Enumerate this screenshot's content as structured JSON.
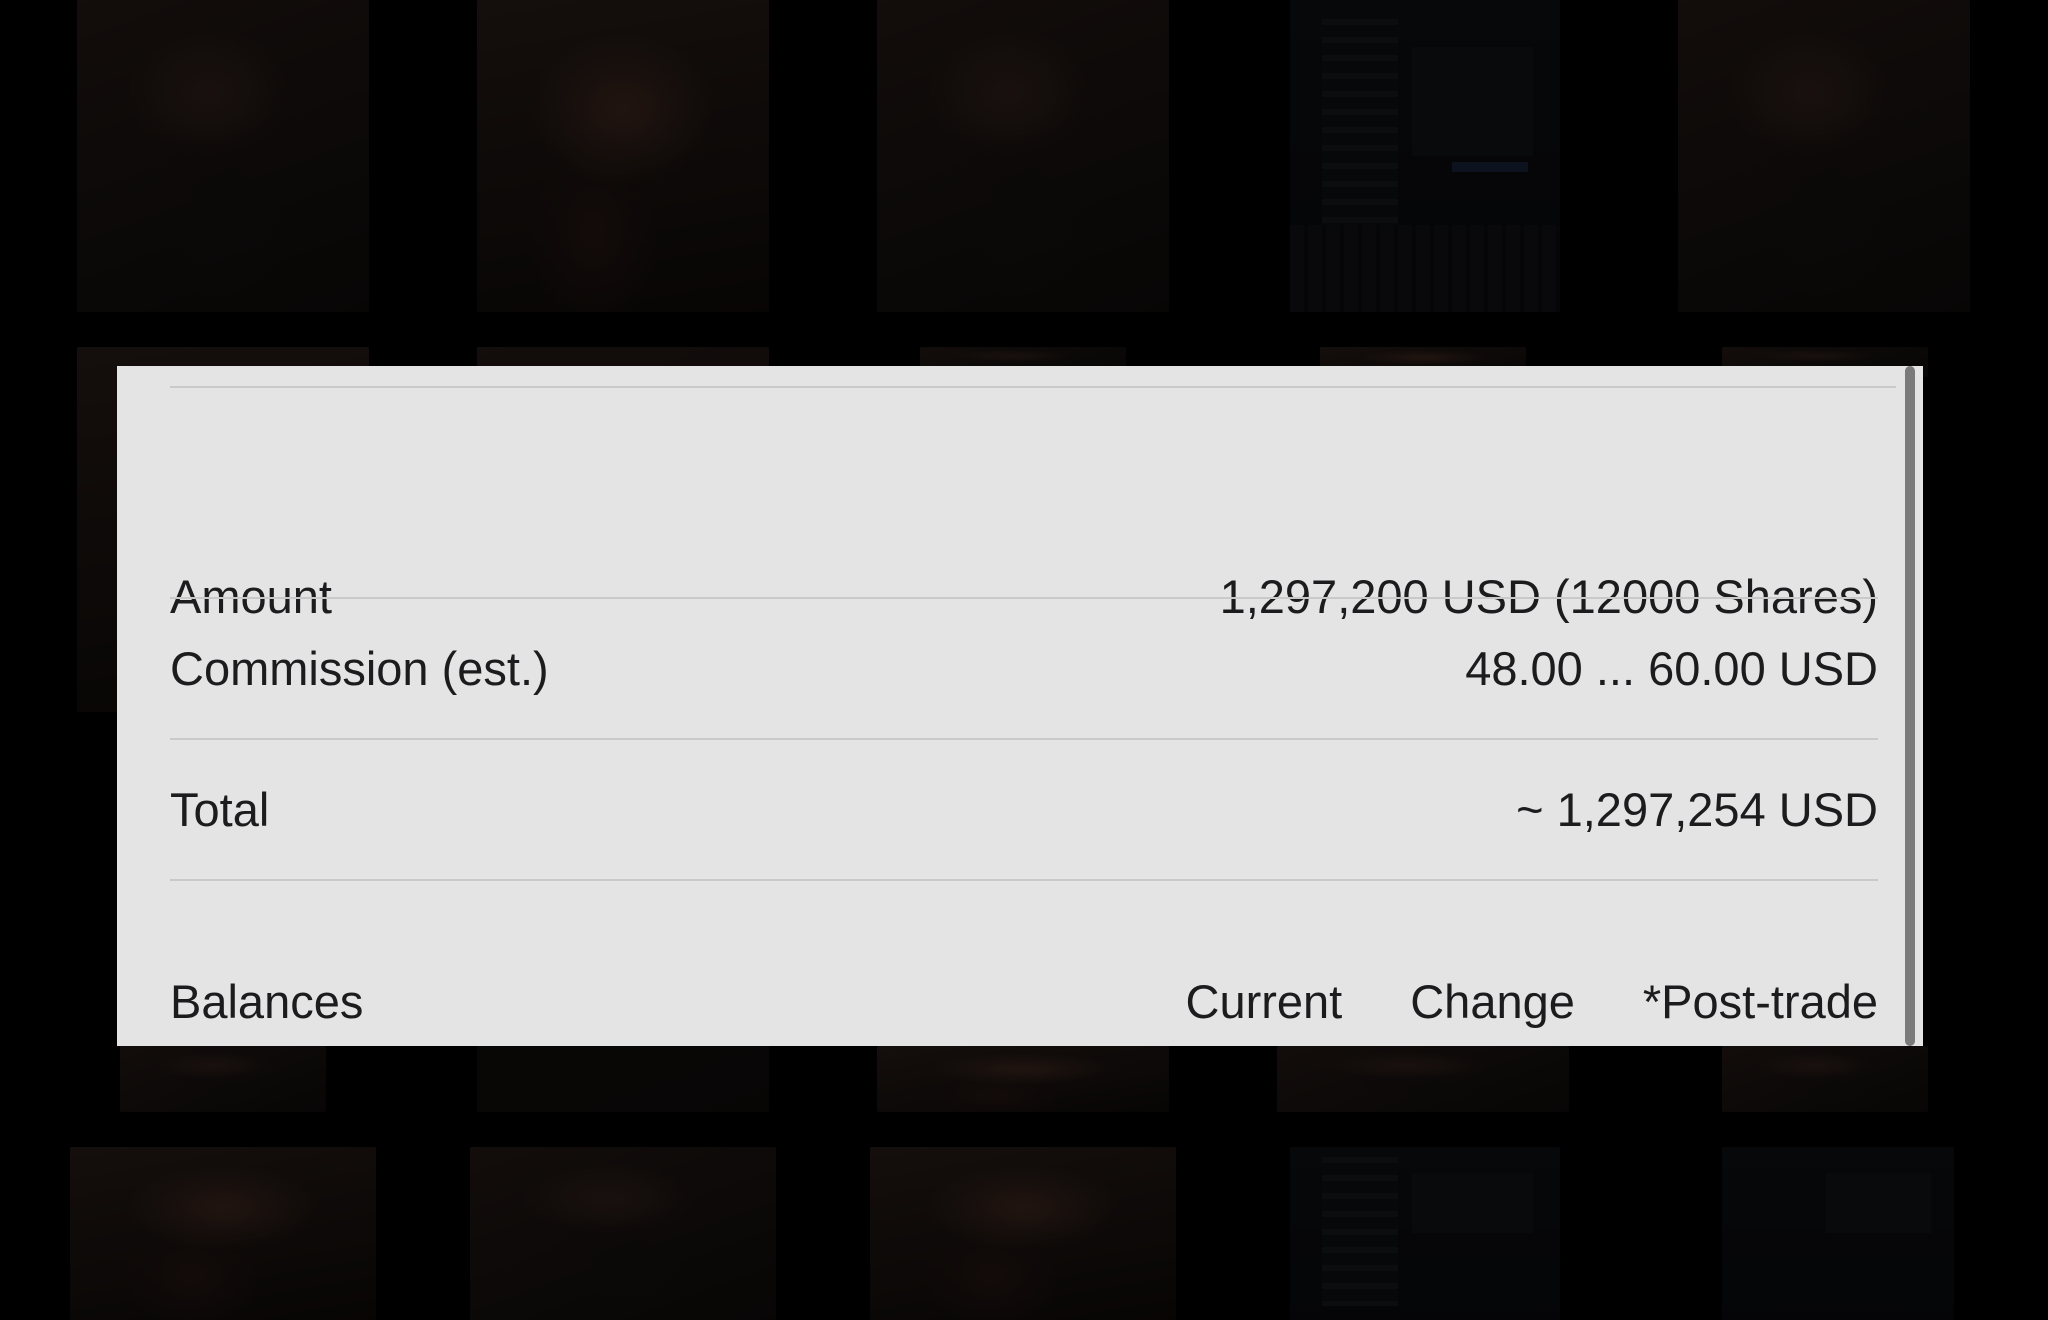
{
  "summary": {
    "amount_label": "Amount",
    "amount_value": "1,297,200 USD (12000 Shares)",
    "commission_label": "Commission (est.)",
    "commission_value": "48.00 ... 60.00 USD",
    "total_label": "Total",
    "total_value": "~ 1,297,254 USD"
  },
  "balances": {
    "label": "Balances",
    "columns": [
      "Current",
      "Change",
      "*Post-trade"
    ]
  }
}
